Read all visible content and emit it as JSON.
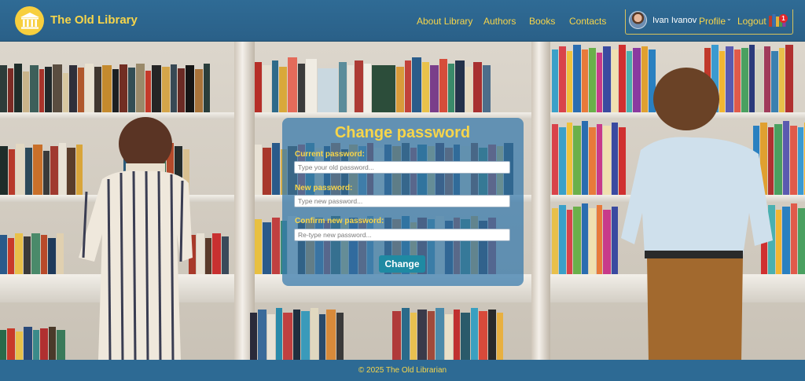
{
  "header": {
    "brand": "The Old Library",
    "nav": [
      {
        "label": "About Library"
      },
      {
        "label": "Authors"
      },
      {
        "label": "Books"
      },
      {
        "label": "Contacts"
      }
    ],
    "user": {
      "name": "Ivan Ivanov",
      "profile_label": "Profile",
      "logout_label": "Logout",
      "notification_count": "1"
    }
  },
  "form": {
    "title": "Change password",
    "current": {
      "label": "Current password:",
      "placeholder": "Type your old password..."
    },
    "new": {
      "label": "New password:",
      "placeholder": "Type new password..."
    },
    "confirm": {
      "label": "Confirm new password:",
      "placeholder": "Re-type new password..."
    },
    "submit_label": "Change"
  },
  "footer": {
    "text": "© 2025 The Old Librarian"
  },
  "colors": {
    "header_bg": "#2f6b95",
    "accent_yellow": "#f7d54a",
    "button": "#1f8aa3",
    "badge": "#e3262a",
    "modal_bg": "#3478ac"
  },
  "icons": {
    "logo": "library-building-icon",
    "profile_chevron": "chevron-down-icon",
    "notifications": "books-icon"
  }
}
